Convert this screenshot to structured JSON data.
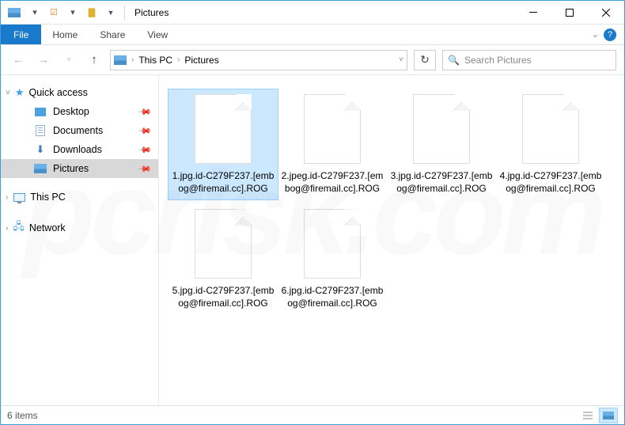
{
  "titlebar": {
    "title": "Pictures"
  },
  "ribbon": {
    "file": "File",
    "tabs": [
      "Home",
      "Share",
      "View"
    ]
  },
  "breadcrumb": {
    "seg1": "This PC",
    "seg2": "Pictures"
  },
  "search": {
    "placeholder": "Search Pictures"
  },
  "sidebar": {
    "quick": "Quick access",
    "items": [
      {
        "label": "Desktop"
      },
      {
        "label": "Documents"
      },
      {
        "label": "Downloads"
      },
      {
        "label": "Pictures"
      }
    ],
    "thispc": "This PC",
    "network": "Network"
  },
  "files": [
    {
      "name": "1.jpg.id-C279F237.[embog@firemail.cc].ROG"
    },
    {
      "name": "2.jpeg.id-C279F237.[embog@firemail.cc].ROG"
    },
    {
      "name": "3.jpg.id-C279F237.[embog@firemail.cc].ROG"
    },
    {
      "name": "4.jpg.id-C279F237.[embog@firemail.cc].ROG"
    },
    {
      "name": "5.jpg.id-C279F237.[embog@firemail.cc].ROG"
    },
    {
      "name": "6.jpg.id-C279F237.[embog@firemail.cc].ROG"
    }
  ],
  "status": {
    "count": "6 items"
  }
}
